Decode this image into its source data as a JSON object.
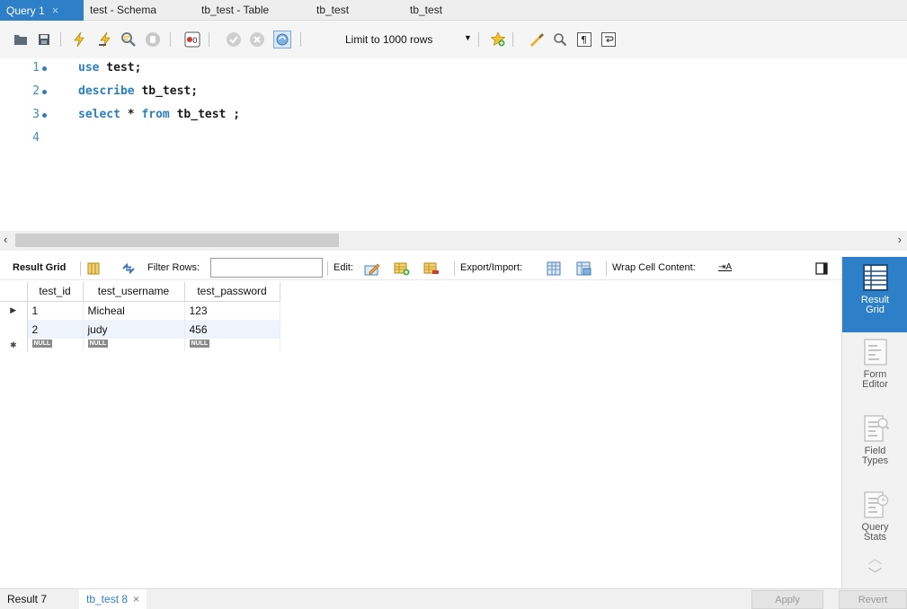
{
  "tabs": [
    {
      "label": "Query 1",
      "close": "×",
      "active": true
    },
    {
      "label": "test - Schema"
    },
    {
      "label": "tb_test - Table"
    },
    {
      "label": "tb_test"
    },
    {
      "label": "tb_test"
    }
  ],
  "toolbar": {
    "limit_label": "Limit to 1000 rows",
    "icons": [
      "folder-open-icon",
      "save-icon",
      "execute-icon",
      "execute-current-icon",
      "explain-icon",
      "stop-icon",
      "toggle-error-icon",
      "commit-icon",
      "rollback-icon",
      "autocommit-icon",
      "add-snippet-icon",
      "beautify-icon",
      "find-icon",
      "invisible-chars-icon",
      "wrap-icon"
    ]
  },
  "editor": {
    "lines": [
      {
        "num": "1",
        "kw": "use",
        "rest": " test;"
      },
      {
        "num": "2",
        "kw": "describe",
        "rest": " tb_test;"
      },
      {
        "num": "3",
        "kw": "select",
        "rest": " * ",
        "kw2": "from",
        "rest2": " tb_test ;"
      },
      {
        "num": "4",
        "kw": "",
        "rest": ""
      }
    ]
  },
  "scrollbar": {
    "left": "‹",
    "right": "›"
  },
  "result_toolbar": {
    "result_grid": "Result Grid",
    "filter_rows": "Filter Rows:",
    "filter_value": "",
    "edit": "Edit:",
    "export_import": "Export/Import:",
    "wrap_cell": "Wrap Cell Content:",
    "wrap_glyph": "⇥A"
  },
  "grid": {
    "columns": [
      "test_id",
      "test_username",
      "test_password"
    ],
    "rows": [
      {
        "marker": "▶",
        "cells": [
          "1",
          "Micheal",
          "123"
        ]
      },
      {
        "marker": "",
        "cells": [
          "2",
          "judy",
          "456"
        ]
      }
    ],
    "new_row_marker": "✱",
    "null_label": "NULL"
  },
  "side_panel": {
    "result_grid": "Result\nGrid",
    "form_editor": "Form\nEditor",
    "field_types": "Field\nTypes",
    "query_stats": "Query\nStats",
    "up": "︿",
    "down": "﹀"
  },
  "bottom": {
    "tabs": [
      {
        "label": "Result 7"
      },
      {
        "label": "tb_test 8",
        "close": "×",
        "active": true
      }
    ],
    "apply": "Apply",
    "revert": "Revert"
  },
  "colors": {
    "accent": "#2d7fc7",
    "keyword": "#2a7fc3",
    "line_number": "#3f8db8"
  }
}
